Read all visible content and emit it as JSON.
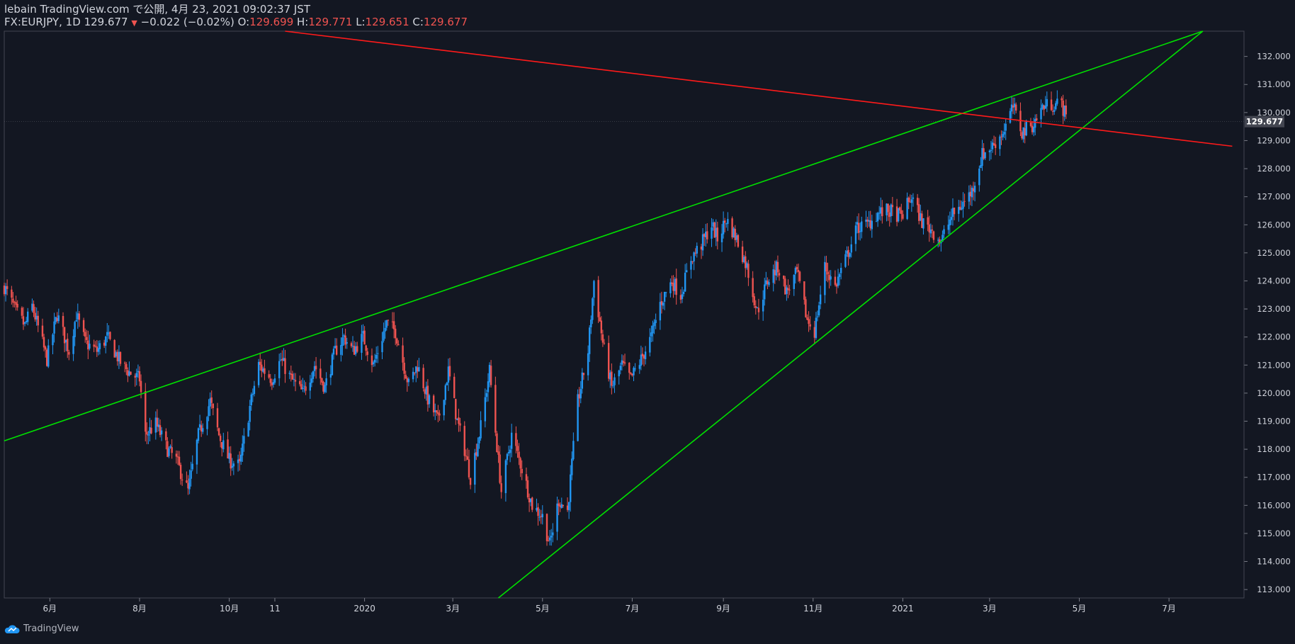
{
  "header": {
    "publish_line": "lebain TradingView.com で公開, 4月 23, 2021 09:02:37 JST",
    "symbol": "FX:EURJPY, 1D",
    "last": "129.677",
    "change": "−0.022 (−0.02%)",
    "o_label": "O:",
    "o_value": "129.699",
    "h_label": "H:",
    "h_value": "129.771",
    "l_label": "L:",
    "l_value": "129.651",
    "c_label": "C:",
    "c_value": "129.677"
  },
  "footer": {
    "brand": "TradingView"
  },
  "colors": {
    "background": "#131722",
    "up": "#2196f3",
    "down": "#ef5350",
    "support_line": "#00e000",
    "resistance_line": "#ff1a1a",
    "text": "#d1d4dc"
  },
  "chart_data": {
    "type": "candlestick",
    "symbol": "FX:EURJPY",
    "interval": "1D",
    "ylim": [
      112.7,
      132.9
    ],
    "y_ticks": [
      "113.000",
      "114.000",
      "115.000",
      "116.000",
      "117.000",
      "118.000",
      "119.000",
      "120.000",
      "121.000",
      "122.000",
      "123.000",
      "124.000",
      "125.000",
      "126.000",
      "127.000",
      "128.000",
      "129.000",
      "130.000",
      "131.000",
      "132.000"
    ],
    "price_label": "129.677",
    "x_ticks": [
      {
        "label": "6月",
        "date": "2019-06-01"
      },
      {
        "label": "8月",
        "date": "2019-08-01"
      },
      {
        "label": "10月",
        "date": "2019-10-01"
      },
      {
        "label": "11",
        "date": "2019-11-01"
      },
      {
        "label": "2020",
        "date": "2020-01-01"
      },
      {
        "label": "3月",
        "date": "2020-03-01"
      },
      {
        "label": "5月",
        "date": "2020-05-01"
      },
      {
        "label": "7月",
        "date": "2020-07-01"
      },
      {
        "label": "9月",
        "date": "2020-09-01"
      },
      {
        "label": "11月",
        "date": "2020-11-01"
      },
      {
        "label": "2021",
        "date": "2021-01-01"
      },
      {
        "label": "3月",
        "date": "2021-03-01"
      },
      {
        "label": "5月",
        "date": "2021-05-01"
      },
      {
        "label": "7月",
        "date": "2021-07-01"
      }
    ],
    "anchors": [
      [
        "2019-05-01",
        123.8
      ],
      [
        "2019-05-08",
        123.0
      ],
      [
        "2019-05-15",
        122.4
      ],
      [
        "2019-05-20",
        123.1
      ],
      [
        "2019-05-30",
        121.2
      ],
      [
        "2019-06-06",
        122.8
      ],
      [
        "2019-06-14",
        121.5
      ],
      [
        "2019-06-19",
        122.8
      ],
      [
        "2019-06-25",
        121.8
      ],
      [
        "2019-07-03",
        121.5
      ],
      [
        "2019-07-10",
        122.0
      ],
      [
        "2019-07-20",
        121.0
      ],
      [
        "2019-07-26",
        120.7
      ],
      [
        "2019-08-01",
        120.5
      ],
      [
        "2019-08-05",
        118.5
      ],
      [
        "2019-08-12",
        118.9
      ],
      [
        "2019-08-20",
        118.0
      ],
      [
        "2019-08-26",
        117.6
      ],
      [
        "2019-09-03",
        116.5
      ],
      [
        "2019-09-10",
        118.5
      ],
      [
        "2019-09-18",
        119.7
      ],
      [
        "2019-09-24",
        118.5
      ],
      [
        "2019-10-01",
        117.6
      ],
      [
        "2019-10-08",
        117.4
      ],
      [
        "2019-10-15",
        119.5
      ],
      [
        "2019-10-21",
        121.0
      ],
      [
        "2019-10-30",
        120.5
      ],
      [
        "2019-11-05",
        121.2
      ],
      [
        "2019-11-12",
        120.5
      ],
      [
        "2019-11-20",
        120.0
      ],
      [
        "2019-11-28",
        121.0
      ],
      [
        "2019-12-05",
        120.2
      ],
      [
        "2019-12-12",
        121.5
      ],
      [
        "2019-12-18",
        122.0
      ],
      [
        "2019-12-24",
        121.5
      ],
      [
        "2019-12-31",
        122.0
      ],
      [
        "2020-01-07",
        121.0
      ],
      [
        "2020-01-16",
        122.5
      ],
      [
        "2020-01-22",
        122.2
      ],
      [
        "2020-01-31",
        120.3
      ],
      [
        "2020-02-06",
        121.0
      ],
      [
        "2020-02-13",
        119.8
      ],
      [
        "2020-02-20",
        119.0
      ],
      [
        "2020-02-27",
        120.8
      ],
      [
        "2020-03-04",
        119.0
      ],
      [
        "2020-03-09",
        118.0
      ],
      [
        "2020-03-13",
        117.0
      ],
      [
        "2020-03-20",
        118.8
      ],
      [
        "2020-03-26",
        120.8
      ],
      [
        "2020-04-03",
        116.5
      ],
      [
        "2020-04-10",
        118.5
      ],
      [
        "2020-04-17",
        117.3
      ],
      [
        "2020-04-24",
        116.0
      ],
      [
        "2020-05-01",
        115.6
      ],
      [
        "2020-05-06",
        114.6
      ],
      [
        "2020-05-12",
        116.2
      ],
      [
        "2020-05-18",
        115.8
      ],
      [
        "2020-05-25",
        119.7
      ],
      [
        "2020-06-01",
        121.5
      ],
      [
        "2020-06-05",
        124.0
      ],
      [
        "2020-06-11",
        121.8
      ],
      [
        "2020-06-17",
        120.2
      ],
      [
        "2020-06-24",
        121.0
      ],
      [
        "2020-06-30",
        120.5
      ],
      [
        "2020-07-07",
        121.2
      ],
      [
        "2020-07-14",
        122.0
      ],
      [
        "2020-07-20",
        123.2
      ],
      [
        "2020-07-28",
        124.0
      ],
      [
        "2020-08-03",
        123.5
      ],
      [
        "2020-08-10",
        124.8
      ],
      [
        "2020-08-17",
        125.3
      ],
      [
        "2020-08-24",
        126.0
      ],
      [
        "2020-08-28",
        125.5
      ],
      [
        "2020-09-03",
        126.2
      ],
      [
        "2020-09-10",
        125.5
      ],
      [
        "2020-09-17",
        124.5
      ],
      [
        "2020-09-24",
        122.9
      ],
      [
        "2020-10-01",
        124.0
      ],
      [
        "2020-10-08",
        124.5
      ],
      [
        "2020-10-14",
        123.6
      ],
      [
        "2020-10-21",
        124.3
      ],
      [
        "2020-10-28",
        122.6
      ],
      [
        "2020-11-02",
        122.2
      ],
      [
        "2020-11-09",
        124.5
      ],
      [
        "2020-11-16",
        123.8
      ],
      [
        "2020-11-24",
        124.9
      ],
      [
        "2020-12-01",
        125.9
      ],
      [
        "2020-12-08",
        126.0
      ],
      [
        "2020-12-15",
        126.4
      ],
      [
        "2020-12-22",
        126.5
      ],
      [
        "2020-12-31",
        126.3
      ],
      [
        "2021-01-07",
        127.0
      ],
      [
        "2021-01-14",
        126.1
      ],
      [
        "2021-01-21",
        125.8
      ],
      [
        "2021-01-27",
        125.4
      ],
      [
        "2021-02-03",
        126.3
      ],
      [
        "2021-02-10",
        126.7
      ],
      [
        "2021-02-17",
        127.2
      ],
      [
        "2021-02-24",
        128.5
      ],
      [
        "2021-03-03",
        128.8
      ],
      [
        "2021-03-10",
        129.3
      ],
      [
        "2021-03-17",
        130.2
      ],
      [
        "2021-03-23",
        129.3
      ],
      [
        "2021-03-31",
        129.6
      ],
      [
        "2021-04-06",
        130.2
      ],
      [
        "2021-04-12",
        130.3
      ],
      [
        "2021-04-19",
        130.3
      ],
      [
        "2021-04-23",
        129.68
      ]
    ],
    "trend_lines": [
      {
        "role": "upper-channel",
        "color": "#00e000",
        "p1": [
          "2019-05-01",
          118.3
        ],
        "p2": [
          "2021-07-24",
          132.9
        ]
      },
      {
        "role": "lower-channel",
        "color": "#00e000",
        "p1": [
          "2020-04-01",
          112.7
        ],
        "p2": [
          "2021-07-24",
          132.9
        ]
      },
      {
        "role": "resistance",
        "color": "#ff1a1a",
        "p1": [
          "2019-11-08",
          132.9
        ],
        "p2": [
          "2021-08-13",
          128.8
        ]
      }
    ]
  }
}
